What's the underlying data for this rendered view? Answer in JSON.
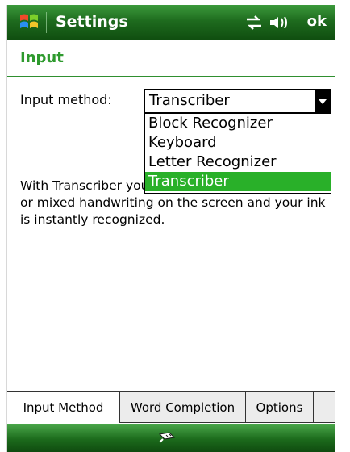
{
  "titlebar": {
    "title": "Settings",
    "ok_label": "ok",
    "icons": [
      "windows-start-icon",
      "connectivity-icon",
      "volume-icon"
    ]
  },
  "page": {
    "heading": "Input"
  },
  "form": {
    "input_method_label": "Input method:",
    "dropdown_value": "Transcriber",
    "options": [
      "Block Recognizer",
      "Keyboard",
      "Letter Recognizer",
      "Transcriber"
    ],
    "selected_option": "Transcriber",
    "description": "With Transcriber you can write in print, cursive, or mixed handwriting on the screen and your ink is instantly recognized."
  },
  "tabs": [
    {
      "label": "Input Method",
      "active": true
    },
    {
      "label": "Word Completion",
      "active": false
    },
    {
      "label": "Options",
      "active": false
    }
  ],
  "bottombar": {
    "icon": "keyboard-input-icon"
  },
  "colors": {
    "accent_green": "#2e9a2e",
    "selection_green": "#29b029",
    "titlebar_green": "#1e6b1e"
  }
}
